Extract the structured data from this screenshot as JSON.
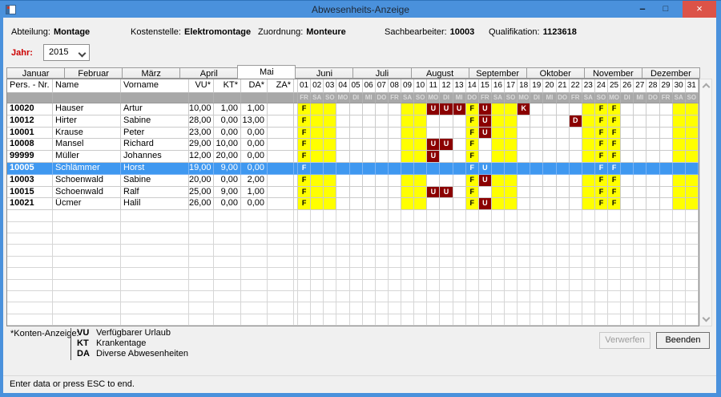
{
  "window": {
    "title": "Abwesenheits-Anzeige"
  },
  "icons": {
    "minimize": "–",
    "maximize": "□",
    "close": "×",
    "app": "form-icon",
    "dropdown": "chevron-down",
    "scroll_up": "chevron-up",
    "scroll_down": "chevron-down"
  },
  "colors": {
    "titlebar_blue": "#4a91dc",
    "close_red": "#dc5348",
    "selection_blue": "#3f98f0",
    "weekend_yellow": "#ffff00",
    "absence_red": "#8b0000",
    "year_label_red": "#cc0000"
  },
  "header": {
    "fields": [
      {
        "label": "Abteilung:",
        "value": "Montage"
      },
      {
        "label": "Kostenstelle:",
        "value": "Elektromontage"
      },
      {
        "label": "Zuordnung:",
        "value": "Monteure"
      },
      {
        "label": "Sachbearbeiter:",
        "value": "10003"
      },
      {
        "label": "Qualifikation:",
        "value": "1123618"
      }
    ],
    "year_label": "Jahr:",
    "year_value": "2015"
  },
  "tabs": [
    "Januar",
    "Februar",
    "März",
    "April",
    "Mai",
    "Juni",
    "Juli",
    "August",
    "September",
    "Oktober",
    "November",
    "Dezember"
  ],
  "active_tab": "Mai",
  "grid": {
    "columns": [
      {
        "key": "nr",
        "label": "Pers. - Nr."
      },
      {
        "key": "name",
        "label": "Name"
      },
      {
        "key": "vorname",
        "label": "Vorname"
      },
      {
        "key": "vu",
        "label": "VU*"
      },
      {
        "key": "kt",
        "label": "KT*"
      },
      {
        "key": "da",
        "label": "DA*"
      },
      {
        "key": "za",
        "label": "ZA*"
      }
    ],
    "days": [
      "01",
      "02",
      "03",
      "04",
      "05",
      "06",
      "07",
      "08",
      "09",
      "10",
      "11",
      "12",
      "13",
      "14",
      "15",
      "16",
      "17",
      "18",
      "19",
      "20",
      "21",
      "22",
      "23",
      "24",
      "25",
      "26",
      "27",
      "28",
      "29",
      "30",
      "31"
    ],
    "weekdays": [
      "FR",
      "SA",
      "SO",
      "MO",
      "DI",
      "MI",
      "DO",
      "FR",
      "SA",
      "SO",
      "MO",
      "DI",
      "MI",
      "DO",
      "FR",
      "SA",
      "SO",
      "MO",
      "DI",
      "MI",
      "DO",
      "FR",
      "SA",
      "SO",
      "MO",
      "DI",
      "MI",
      "DO",
      "FR",
      "SA",
      "SO"
    ],
    "yellow_days": [
      1,
      2,
      3,
      9,
      10,
      14,
      16,
      17,
      23,
      24,
      25,
      30,
      31
    ],
    "selected_nr": "10005",
    "rows": [
      {
        "nr": "10020",
        "name": "Hauser",
        "vorname": "Artur",
        "vu": "10,00",
        "kt": "1,00",
        "da": "1,00",
        "za": "",
        "marks": {
          "1": "F",
          "11": "U",
          "12": "U",
          "13": "U",
          "14": "F",
          "15": "U",
          "18": "K",
          "24": "F",
          "25": "F"
        }
      },
      {
        "nr": "10012",
        "name": "Hirter",
        "vorname": "Sabine",
        "vu": "28,00",
        "kt": "0,00",
        "da": "13,00",
        "za": "",
        "marks": {
          "1": "F",
          "14": "F",
          "15": "U",
          "22": "D",
          "24": "F",
          "25": "F"
        }
      },
      {
        "nr": "10001",
        "name": "Krause",
        "vorname": "Peter",
        "vu": "23,00",
        "kt": "0,00",
        "da": "0,00",
        "za": "",
        "marks": {
          "1": "F",
          "14": "F",
          "15": "U",
          "24": "F",
          "25": "F"
        }
      },
      {
        "nr": "10008",
        "name": "Mansel",
        "vorname": "Richard",
        "vu": "29,00",
        "kt": "10,00",
        "da": "0,00",
        "za": "",
        "marks": {
          "1": "F",
          "11": "U",
          "12": "U",
          "14": "F",
          "24": "F",
          "25": "F"
        }
      },
      {
        "nr": "99999",
        "name": "Müller",
        "vorname": "Johannes",
        "vu": "12,00",
        "kt": "20,00",
        "da": "0,00",
        "za": "",
        "marks": {
          "1": "F",
          "11": "U",
          "14": "F",
          "24": "F",
          "25": "F"
        }
      },
      {
        "nr": "10005",
        "name": "Schlämmer",
        "vorname": "Horst",
        "vu": "19,00",
        "kt": "9,00",
        "da": "0,00",
        "za": "",
        "marks": {
          "1": "F",
          "14": "F",
          "15": "U",
          "24": "F",
          "25": "F"
        }
      },
      {
        "nr": "10003",
        "name": "Schoenwald",
        "vorname": "Sabine",
        "vu": "20,00",
        "kt": "0,00",
        "da": "2,00",
        "za": "",
        "marks": {
          "1": "F",
          "14": "F",
          "15": "U",
          "24": "F",
          "25": "F"
        }
      },
      {
        "nr": "10015",
        "name": "Schoenwald",
        "vorname": "Ralf",
        "vu": "25,00",
        "kt": "9,00",
        "da": "1,00",
        "za": "",
        "marks": {
          "1": "F",
          "11": "U",
          "12": "U",
          "14": "F",
          "24": "F",
          "25": "F"
        }
      },
      {
        "nr": "10021",
        "name": "Ücmer",
        "vorname": "Halil",
        "vu": "26,00",
        "kt": "0,00",
        "da": "0,00",
        "za": "",
        "marks": {
          "1": "F",
          "14": "F",
          "15": "U",
          "24": "F",
          "25": "F"
        }
      }
    ]
  },
  "legend": {
    "label": "*Konten-Anzeige:",
    "items": [
      {
        "abbr": "VU",
        "text": "Verfügbarer Urlaub"
      },
      {
        "abbr": "KT",
        "text": "Krankentage"
      },
      {
        "abbr": "DA",
        "text": "Diverse Abwesenheiten"
      }
    ]
  },
  "buttons": {
    "verwerfen": "Verwerfen",
    "beenden": "Beenden"
  },
  "statusbar": {
    "text": "Enter data or press ESC to end."
  }
}
